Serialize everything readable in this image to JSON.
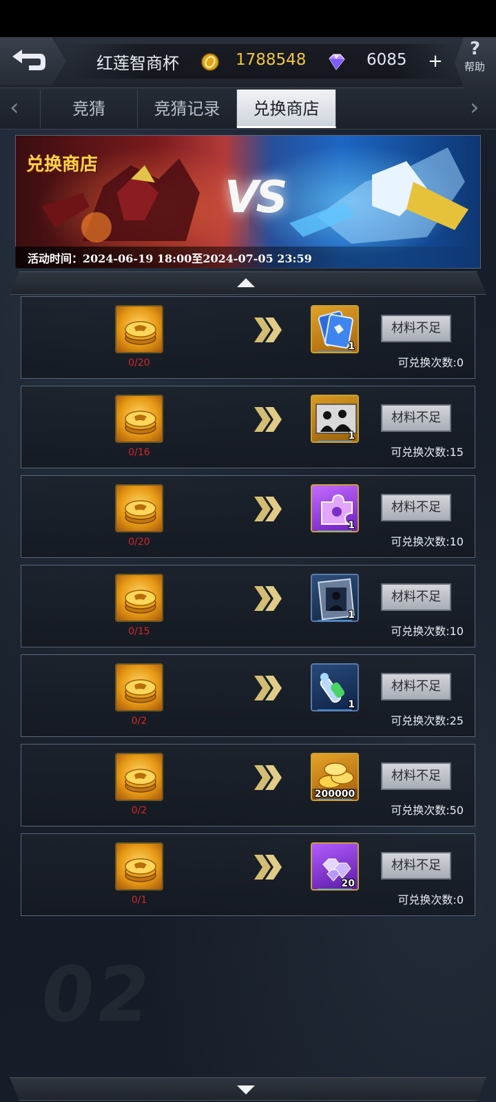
{
  "header": {
    "title": "红莲智商杯",
    "coins": "1788548",
    "gems": "6085",
    "plus": "+",
    "help_label": "帮助",
    "help_symbol": "?"
  },
  "tabs": [
    {
      "label": "竞猜"
    },
    {
      "label": "竞猜记录"
    },
    {
      "label": "兑换商店"
    }
  ],
  "banner": {
    "title": "兑换商店",
    "vs": "VS",
    "time": "活动时间：2024-06-19 18:00至2024-07-05 23:59"
  },
  "button_label": "材料不足",
  "rows": [
    {
      "cost": "0/20",
      "reward_icon": "blue-card-icon",
      "reward_count": "1",
      "limit": "可兑换次数:0"
    },
    {
      "cost": "0/16",
      "reward_icon": "silhouette-card-icon",
      "reward_count": "1",
      "limit": "可兑换次数:15"
    },
    {
      "cost": "0/20",
      "reward_icon": "purple-puzzle-icon",
      "reward_count": "1",
      "limit": "可兑换次数:10"
    },
    {
      "cost": "0/15",
      "reward_icon": "target-card-icon",
      "reward_count": "1",
      "limit": "可兑换次数:10"
    },
    {
      "cost": "0/2",
      "reward_icon": "tech-capsule-icon",
      "reward_count": "1",
      "limit": "可兑换次数:25"
    },
    {
      "cost": "0/2",
      "reward_icon": "gold-coins-icon",
      "reward_count": "200000",
      "limit": "可兑换次数:50"
    },
    {
      "cost": "0/1",
      "reward_icon": "diamonds-icon",
      "reward_count": "20",
      "limit": "可兑换次数:0"
    }
  ],
  "colors": {
    "coin": "#f2c640",
    "cost_insufficient": "#d62828",
    "active_tab": "#e9ecf0"
  }
}
